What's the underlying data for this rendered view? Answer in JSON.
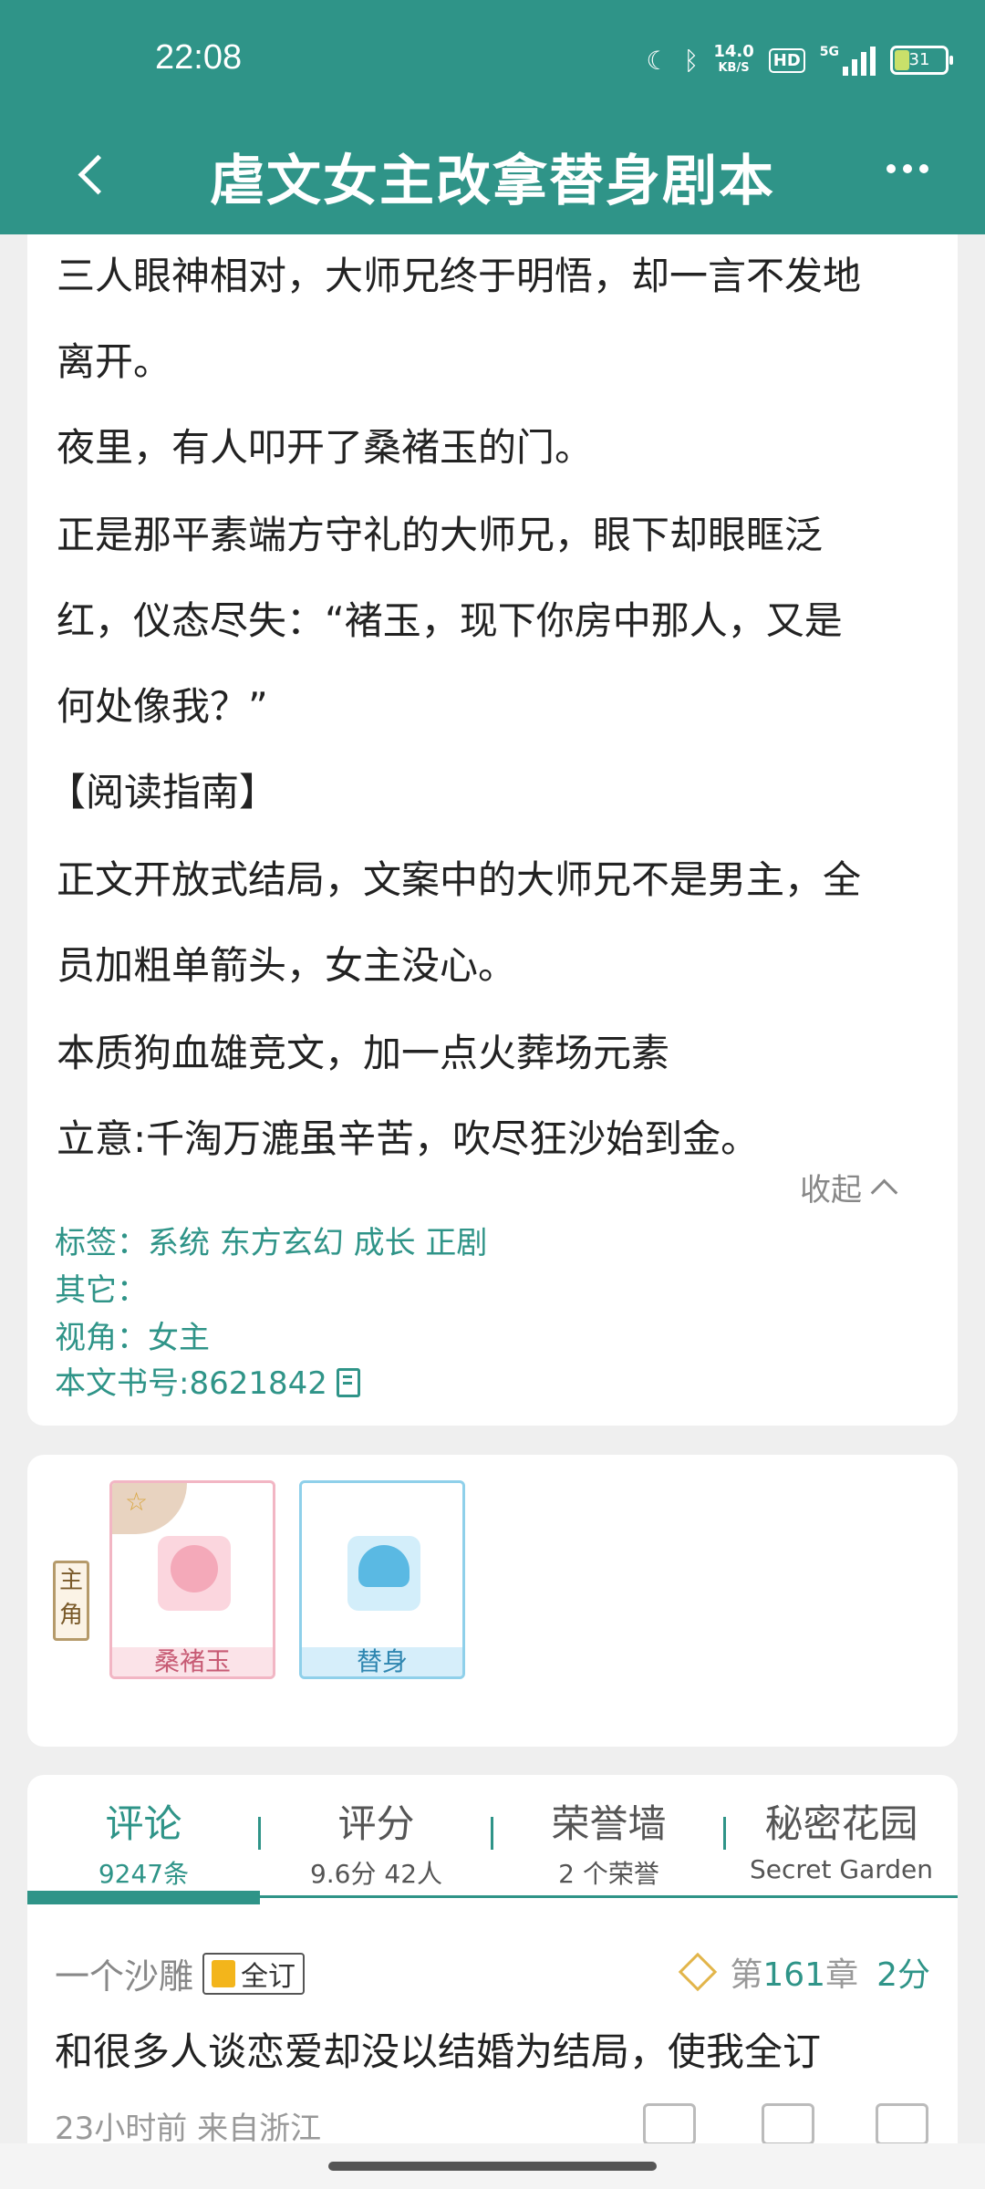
{
  "status": {
    "time": "22:08",
    "net_speed": "14.0",
    "net_unit": "KB/S",
    "hd": "HD",
    "signal": "5G",
    "battery": "31"
  },
  "appbar": {
    "title": "虐文女主改拿替身剧本"
  },
  "intro": {
    "lines": [
      "三人眼神相对，大师兄终于明悟，却一言不发地",
      "离开。",
      "夜里，有人叩开了桑褚玉的门。",
      "正是那平素端方守礼的大师兄，眼下却眼眶泛",
      "红，仪态尽失：“褚玉，现下你房中那人，又是",
      "何处像我？”",
      "【阅读指南】",
      "正文开放式结局，文案中的大师兄不是男主，全",
      "员加粗单箭头，女主没心。",
      "本质狗血雄竞文，加一点火葬场元素",
      "立意:千淘万漉虽辛苦，吹尽狂沙始到金。"
    ],
    "collapse_label": "收起"
  },
  "meta": {
    "tags": "标签：系统 东方玄幻 成长 正剧",
    "other": "其它：",
    "perspective": "视角：女主",
    "book_id": "本文书号:8621842"
  },
  "roles": {
    "tag": "主角",
    "cards": [
      {
        "name": "桑褚玉"
      },
      {
        "name": "替身"
      }
    ]
  },
  "tabs": [
    {
      "label": "评论",
      "sub": "9247条"
    },
    {
      "label": "评分",
      "sub": "9.6分 42人"
    },
    {
      "label": "荣誉墙",
      "sub": "2 个荣誉"
    },
    {
      "label": "秘密花园",
      "sub": "Secret Garden"
    }
  ],
  "comment": {
    "user": "一个沙雕",
    "badge": "全订",
    "chapter_prefix": "第",
    "chapter_num": "161",
    "chapter_suffix": "章",
    "score": "2分",
    "text": "和很多人谈恋爱却没以结婚为结局，使我全订",
    "time": "23小时前  来自浙江"
  }
}
